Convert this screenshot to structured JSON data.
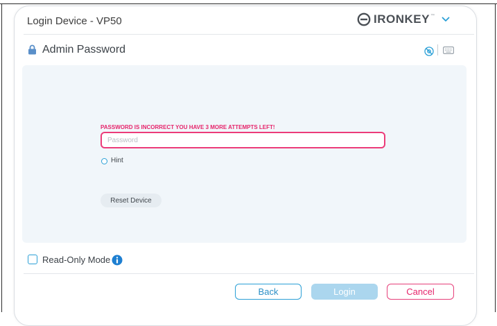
{
  "window": {
    "title": "Login Device - VP50"
  },
  "brand": {
    "name": "IRONKEY",
    "trademark": "™",
    "logo_icon": "ironkey-logo-icon",
    "menu_icon": "chevron-down-icon"
  },
  "section": {
    "title": "Admin Password",
    "icon": "lock-icon"
  },
  "toolbar": {
    "icons": [
      "eye-slash-icon",
      "keyboard-icon"
    ]
  },
  "form": {
    "error_message": "PASSWORD IS INCORRECT YOU HAVE 3 MORE ATTEMPTS LEFT!",
    "password_placeholder": "Password",
    "password_value": "",
    "hint_label": "Hint",
    "reset_label": "Reset Device"
  },
  "footer": {
    "readonly_label": "Read-Only Mode",
    "readonly_checked": false,
    "info_icon": "info-icon",
    "back_label": "Back",
    "login_label": "Login",
    "cancel_label": "Cancel"
  },
  "colors": {
    "accent": "#2a9fd6",
    "error": "#e6246b",
    "panel_bg": "#f1f6fa",
    "login_disabled": "#abd6ee"
  }
}
